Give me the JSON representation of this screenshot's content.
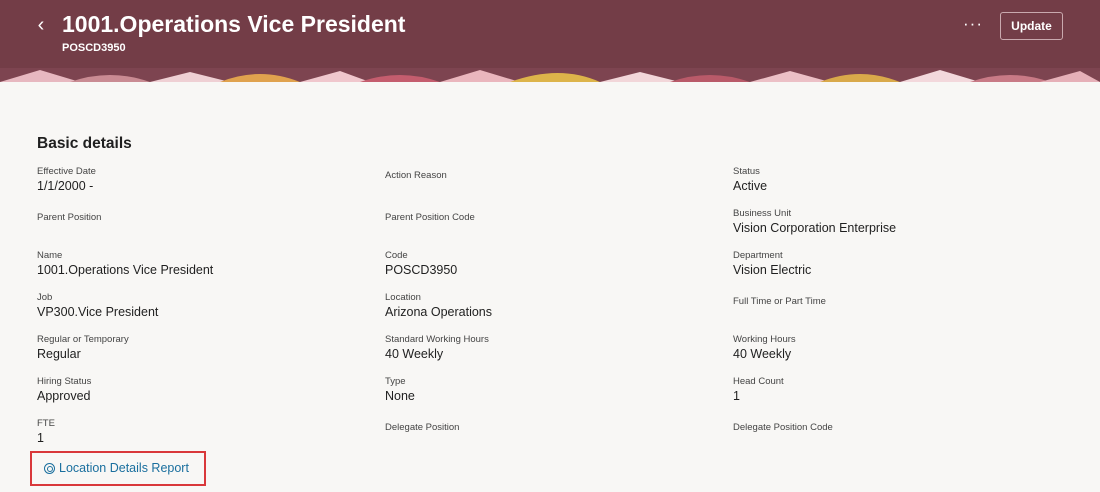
{
  "header": {
    "title": "1001.Operations Vice President",
    "subtitle": "POSCD3950",
    "back_icon": "‹",
    "more_icon": "···",
    "update_label": "Update"
  },
  "section": {
    "title": "Basic details",
    "fields": [
      {
        "label": "Effective Date",
        "value": "1/1/2000 -"
      },
      {
        "label": "Action Reason",
        "value": ""
      },
      {
        "label": "Status",
        "value": "Active"
      },
      {
        "label": "Parent Position",
        "value": ""
      },
      {
        "label": "Parent Position Code",
        "value": ""
      },
      {
        "label": "Business Unit",
        "value": "Vision Corporation Enterprise"
      },
      {
        "label": "Name",
        "value": "1001.Operations Vice President"
      },
      {
        "label": "Code",
        "value": "POSCD3950"
      },
      {
        "label": "Department",
        "value": "Vision Electric"
      },
      {
        "label": "Job",
        "value": "VP300.Vice President"
      },
      {
        "label": "Location",
        "value": "Arizona Operations"
      },
      {
        "label": "Full Time or Part Time",
        "value": ""
      },
      {
        "label": "Regular or Temporary",
        "value": "Regular"
      },
      {
        "label": "Standard Working Hours",
        "value": "40 Weekly"
      },
      {
        "label": "Working Hours",
        "value": "40 Weekly"
      },
      {
        "label": "Hiring Status",
        "value": "Approved"
      },
      {
        "label": "Type",
        "value": "None"
      },
      {
        "label": "Head Count",
        "value": "1"
      },
      {
        "label": "FTE",
        "value": "1"
      },
      {
        "label": "Delegate Position",
        "value": ""
      },
      {
        "label": "Delegate Position Code",
        "value": ""
      }
    ]
  },
  "link": {
    "label": "Location Details Report"
  },
  "colors": {
    "header_bg": "#733d47",
    "link": "#1a6f9e",
    "highlight_border": "#d9383a"
  }
}
